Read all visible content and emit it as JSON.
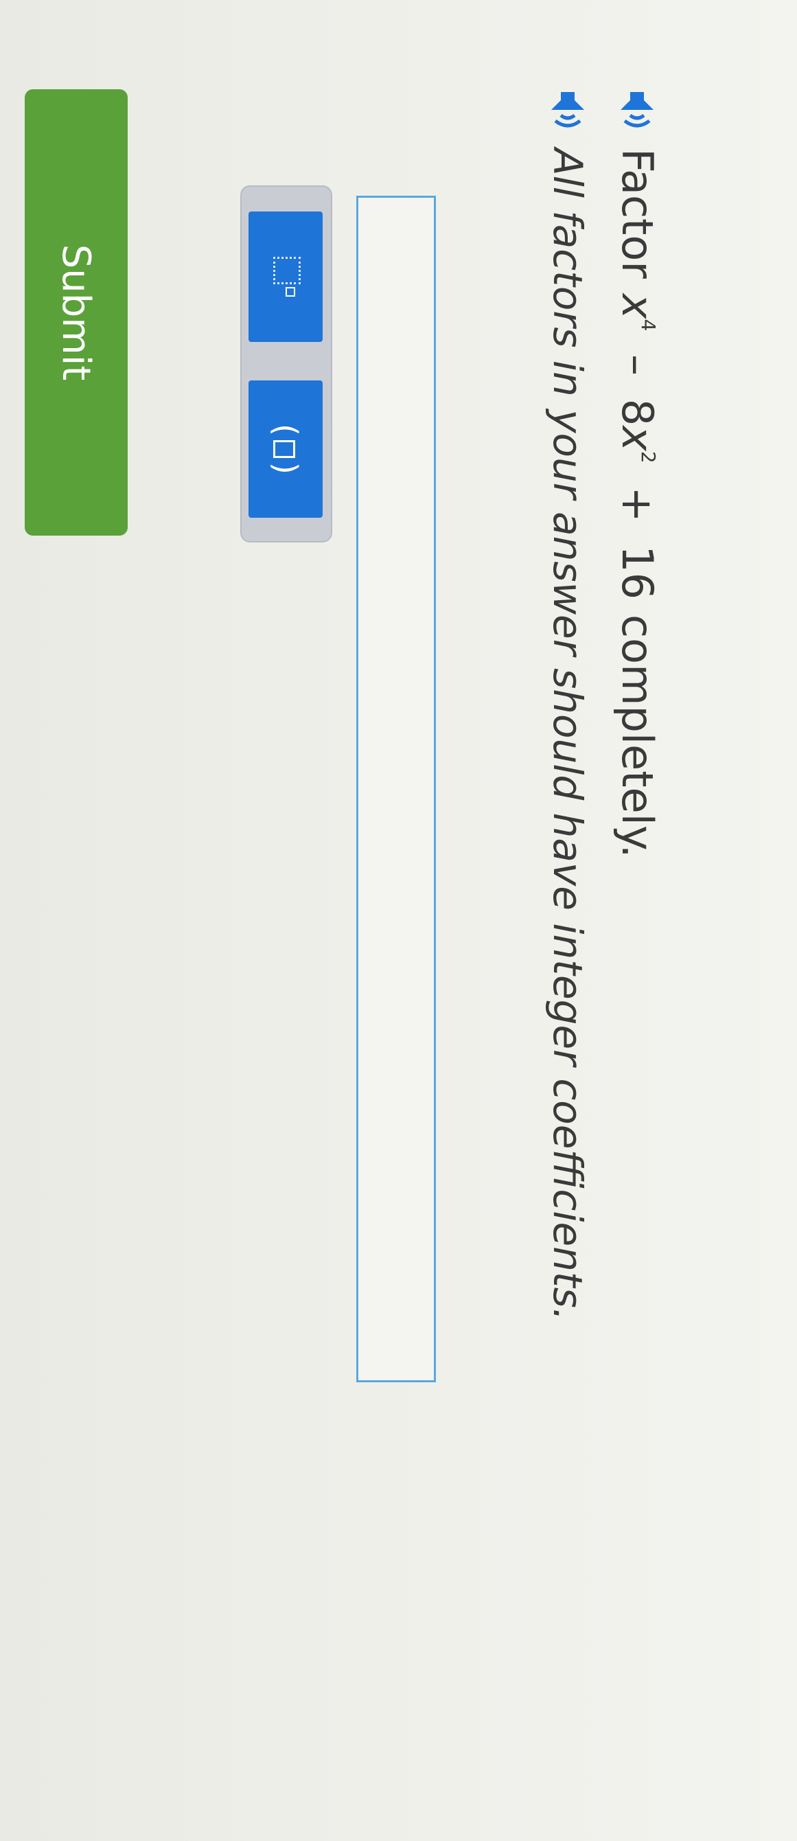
{
  "question": {
    "prefix": "Factor",
    "term1_var": "x",
    "term1_exp": "4",
    "op1": "–",
    "term2_coef": "8",
    "term2_var": "x",
    "term2_exp": "2",
    "op2": "+",
    "constant": "16",
    "suffix": "completely."
  },
  "instruction": "All factors in your answer should have integer coefficients.",
  "answer": {
    "value": ""
  },
  "toolbar": {
    "paren_open": "(",
    "paren_close": ")"
  },
  "submit_label": "Submit",
  "colors": {
    "accent_blue": "#1f74d8",
    "submit_green": "#5aa13a",
    "input_border": "#5aa7e0",
    "speaker_blue": "#1f74d8"
  },
  "icons": {
    "speaker": "speaker-icon",
    "exponent_template": "exponent-template-icon",
    "parentheses_template": "parentheses-template-icon"
  }
}
